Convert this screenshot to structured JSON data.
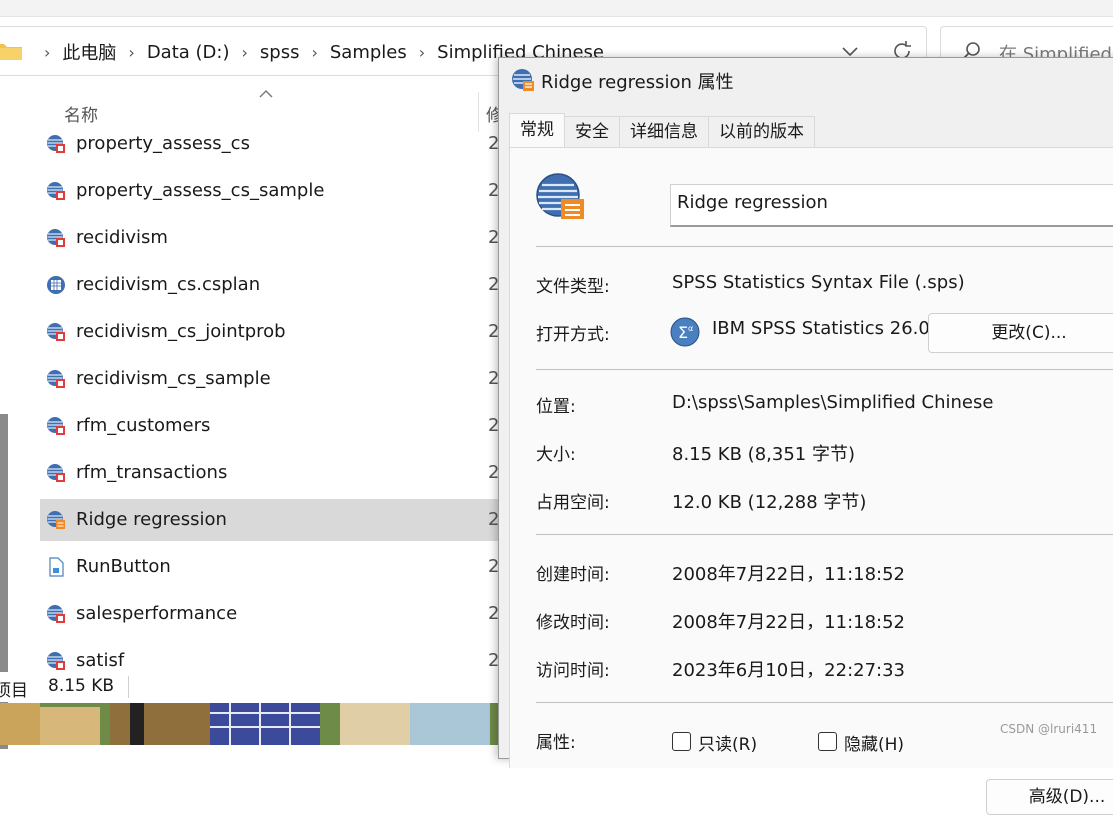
{
  "explorer": {
    "breadcrumb": [
      "此电脑",
      "Data (D:)",
      "spss",
      "Samples",
      "Simplified Chinese"
    ],
    "search_placeholder": "在 Simplified",
    "columns": {
      "name": "名称",
      "date": "修"
    },
    "files": [
      {
        "name": "property_assess_cs",
        "date": "2",
        "icon": "sav-data-icon"
      },
      {
        "name": "property_assess_cs_sample",
        "date": "2",
        "icon": "sav-data-icon"
      },
      {
        "name": "recidivism",
        "date": "2",
        "icon": "sav-data-icon"
      },
      {
        "name": "recidivism_cs.csplan",
        "date": "2",
        "icon": "csplan-icon"
      },
      {
        "name": "recidivism_cs_jointprob",
        "date": "2",
        "icon": "sav-data-icon"
      },
      {
        "name": "recidivism_cs_sample",
        "date": "2",
        "icon": "sav-data-icon"
      },
      {
        "name": "rfm_customers",
        "date": "2",
        "icon": "sav-data-icon"
      },
      {
        "name": "rfm_transactions",
        "date": "2",
        "icon": "sav-data-icon"
      },
      {
        "name": "Ridge regression",
        "date": "2",
        "icon": "syntax-file-icon",
        "selected": true
      },
      {
        "name": "RunButton",
        "date": "2",
        "icon": "generic-file-icon"
      },
      {
        "name": "salesperformance",
        "date": "2",
        "icon": "sav-data-icon"
      },
      {
        "name": "satisf",
        "date": "2",
        "icon": "sav-data-icon"
      }
    ],
    "status": {
      "items_label": "项目",
      "size": "8.15 KB"
    }
  },
  "dialog": {
    "title": "Ridge regression 属性",
    "tabs": [
      "常规",
      "安全",
      "详细信息",
      "以前的版本"
    ],
    "active_tab": 0,
    "file_name": "Ridge regression",
    "props": {
      "type_label": "文件类型:",
      "type_value": "SPSS Statistics Syntax File (.sps)",
      "openwith_label": "打开方式:",
      "openwith_value": "IBM SPSS Statistics 26.0",
      "change_button": "更改(C)...",
      "location_label": "位置:",
      "location_value": "D:\\spss\\Samples\\Simplified Chinese",
      "size_label": "大小:",
      "size_value": "8.15 KB (8,351 字节)",
      "disk_label": "占用空间:",
      "disk_value": "12.0 KB (12,288 字节)",
      "created_label": "创建时间:",
      "created_value": "2008年7月22日，11:18:52",
      "modified_label": "修改时间:",
      "modified_value": "2008年7月22日，11:18:52",
      "accessed_label": "访问时间:",
      "accessed_value": "2023年6月10日，22:27:33",
      "attr_label": "属性:",
      "readonly_label": "只读(R)",
      "hidden_label": "隐藏(H)",
      "advanced_button": "高级(D)..."
    }
  },
  "watermark": "CSDN @lruri411"
}
